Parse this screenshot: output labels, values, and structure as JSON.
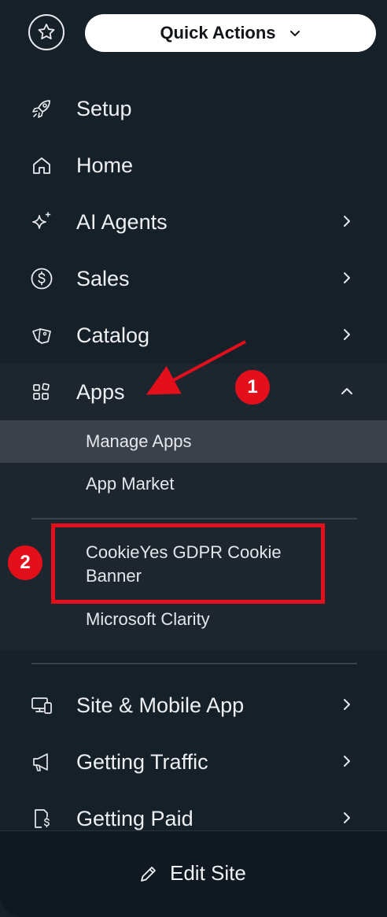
{
  "quick_actions": {
    "label": "Quick Actions"
  },
  "nav": {
    "setup": "Setup",
    "home": "Home",
    "ai_agents": "AI Agents",
    "sales": "Sales",
    "catalog": "Catalog",
    "apps": "Apps",
    "site_mobile": "Site & Mobile App",
    "getting_traffic": "Getting Traffic",
    "getting_paid": "Getting Paid"
  },
  "apps_submenu": {
    "manage_apps": "Manage Apps",
    "app_market": "App Market",
    "cookieyes_line1": "CookieYes GDPR Cookie",
    "cookieyes_line2": "Banner",
    "microsoft_clarity": "Microsoft Clarity"
  },
  "annotations": {
    "badge_1": "1",
    "badge_2": "2"
  },
  "footer": {
    "edit_site": "Edit Site"
  },
  "colors": {
    "sidebar_bg": "#162029",
    "apps_section_bg": "#1d262f",
    "selected_item_bg": "#3b414a",
    "annotation_red": "#e3101c"
  },
  "icons": {
    "header": [
      "star-icon",
      "chevron-down-icon"
    ],
    "nav": [
      "rocket-icon",
      "home-icon",
      "sparkle-icon",
      "dollar-circle-icon",
      "tag-icon",
      "apps-grid-icon",
      "desktop-mobile-icon",
      "megaphone-icon",
      "invoice-dollar-icon"
    ],
    "footer": [
      "pencil-icon"
    ]
  }
}
